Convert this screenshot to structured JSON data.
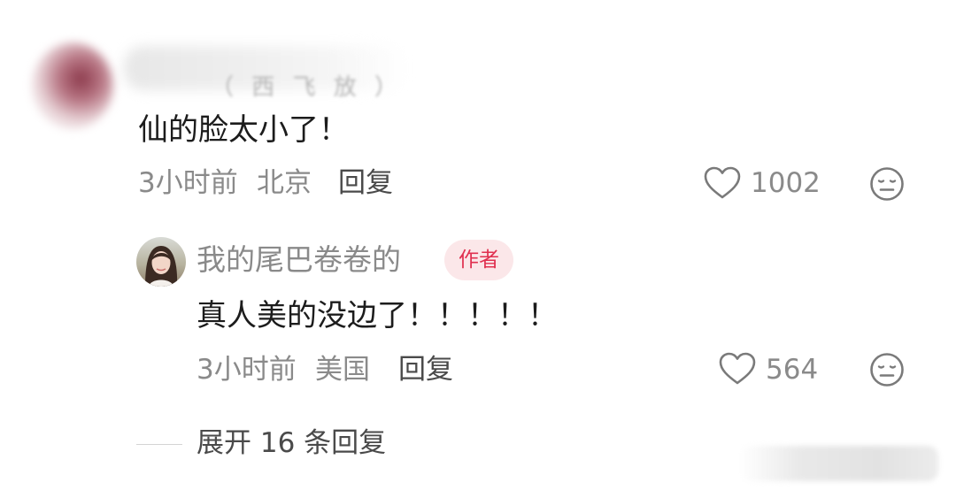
{
  "top_comment": {
    "author_residue": "（  西  飞  放  ）",
    "text": "仙的脸太小了！",
    "time": "3小时前",
    "location": "北京",
    "reply_label": "回复",
    "likes": "1002",
    "like_icon": "heart-icon",
    "reaction_icon": "meh-face-icon"
  },
  "author_reply": {
    "author_name": "我的尾巴卷卷的",
    "author_badge": "作者",
    "text": "真人美的没边了！！！！！",
    "time": "3小时前",
    "location": "美国",
    "reply_label": "回复",
    "likes": "564",
    "like_icon": "heart-icon",
    "reaction_icon": "meh-face-icon"
  },
  "expand_replies": {
    "label": "展开 16 条回复"
  },
  "colors": {
    "badge_text": "#e03050",
    "badge_bg": "#fbe7e9",
    "meta_text": "#8a8a8a",
    "body_text": "#1c1c1c"
  }
}
